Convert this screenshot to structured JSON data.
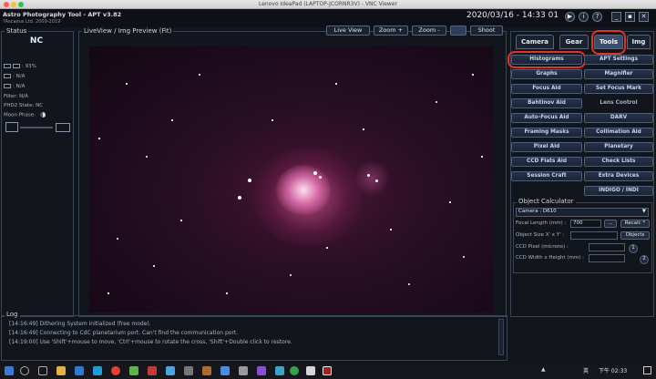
{
  "window": {
    "title": "Lenovo IdeaPad (LAPTOP-JCORNR3V) - VNC Viewer"
  },
  "app": {
    "name": "Astro Photography Tool  -  APT v3.82",
    "copyright": "?Ascaeus Ltd. 2009-2019",
    "datetime": "2020/03/16  -  14:33  01"
  },
  "status": {
    "title": "Status",
    "connection": "NC",
    "battery": ": 93%",
    "storage1": ": N/A",
    "storage2": ": N/A",
    "filter": "Filter: N/A",
    "phd2": "PHD2 State: NC",
    "moon": "Moon Phase:"
  },
  "preview": {
    "title": "LiveView / Img Preview (Fit)",
    "buttons": [
      "Live View",
      "Zoom +",
      "Zoom -",
      "Shoot"
    ]
  },
  "tabs": [
    "Camera",
    "Gear",
    "Tools",
    "Img"
  ],
  "active_tab": "Tools",
  "tools": {
    "left": [
      "Histograms",
      "Graphs",
      "Focus Aid",
      "Bahtinov Aid",
      "Auto-Focus Aid",
      "Framing Masks",
      "Pixel Aid",
      "CCD Flats Aid",
      "Session Craft"
    ],
    "right": [
      "APT Settings",
      "Magnifier",
      "Set Focus Mark",
      "Lens Control",
      "DARV",
      "Collimation Aid",
      "Planetary",
      "Check Lists",
      "Extra Devices",
      "INDIGO / INDI"
    ]
  },
  "object_calculator": {
    "title": "Object Calculator",
    "camera": "Camera : D610",
    "focal_label": "Focal Length (mm) :",
    "focal_value": "700",
    "more_btn": "...",
    "recalc_btn": "Recalc *",
    "size_label": "Object Size X' x Y' :",
    "objects_btn": "Objects",
    "pixel_label": "CCD Pixel (microns) :",
    "wh_label": "CCD Width x Height (mm) :",
    "btn1": "1",
    "btn2": "2"
  },
  "log": {
    "title": "Log",
    "lines": [
      "[14:16:49] Dithering System initialized (free mode).",
      "[14:16:49] Connecting to CdC planetarium port. Can't find the communication port.",
      "[14:19:00] Use 'Shift'+mouse to move, 'Ctrl'+mouse to rotate the cross, 'Shift'+Double click to restore."
    ]
  },
  "taskbar": {
    "time": "下午 02:33",
    "lang": "英"
  },
  "colors": {
    "highlight": "#e2332a",
    "accent": "#3a4d6b"
  }
}
